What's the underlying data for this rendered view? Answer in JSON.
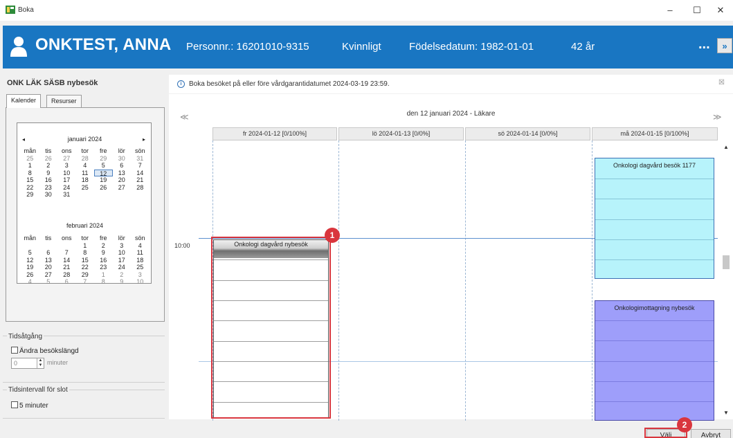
{
  "window": {
    "title": "Boka",
    "controls": [
      "–",
      "☐",
      "✕"
    ]
  },
  "patient": {
    "name": "ONKTEST, ANNA",
    "personnr": "Personnr.: 16201010-9315",
    "gender": "Kvinnligt",
    "birthdate": "Födelsedatum: 1982-01-01",
    "age": "42 år",
    "more_label": "...",
    "expand_label": "»"
  },
  "left": {
    "title": "ONK LÄK SÄSB nybesök",
    "tabs": [
      "Kalender",
      "Resurser"
    ],
    "calendar": {
      "prev": "◂",
      "next": "▸",
      "dow": [
        "mån",
        "tis",
        "ons",
        "tor",
        "fre",
        "lör",
        "sön"
      ],
      "january": {
        "title": "januari 2024",
        "days": [
          "25",
          "26",
          "27",
          "28",
          "29",
          "30",
          "31",
          "1",
          "2",
          "3",
          "4",
          "5",
          "6",
          "7",
          "8",
          "9",
          "10",
          "11",
          "12",
          "13",
          "14",
          "15",
          "16",
          "17",
          "18",
          "19",
          "20",
          "21",
          "22",
          "23",
          "24",
          "25",
          "26",
          "27",
          "28",
          "29",
          "30",
          "31"
        ]
      },
      "february": {
        "title": "februari 2024",
        "days": [
          "",
          "",
          "",
          "1",
          "2",
          "3",
          "4",
          "5",
          "6",
          "7",
          "8",
          "9",
          "10",
          "11",
          "12",
          "13",
          "14",
          "15",
          "16",
          "17",
          "18",
          "19",
          "20",
          "21",
          "22",
          "23",
          "24",
          "25",
          "26",
          "27",
          "28",
          "29",
          "1",
          "2",
          "3",
          "4",
          "5",
          "6",
          "7",
          "8",
          "9",
          "10"
        ]
      },
      "selected_day": "12"
    },
    "duration": {
      "label": "Tidsåtgång",
      "checkbox": "Ändra besökslängd",
      "value": "0",
      "unit": "minuter"
    },
    "interval": {
      "label": "Tidsintervall för slot",
      "checkbox": "5 minuter"
    }
  },
  "info": {
    "icon": "i",
    "text": "Boka besöket på eller före vårdgarantidatumet 2024-03-19 23:59.",
    "close": "☒"
  },
  "schedule": {
    "prev": "≪",
    "next": "≫",
    "title": "den 12 januari 2024 - Läkare",
    "columns": [
      "fr 2024-01-12  [0/100%]",
      "lö 2024-01-13  [0/0%]",
      "sö 2024-01-14  [0/0%]",
      "må 2024-01-15  [0/100%]"
    ],
    "time_label": "10:00",
    "blocks": {
      "grey": "Onkologi dagvård nybesök",
      "cyan": "Onkologi dagvård besök 1177",
      "violet": "Onkologimottagning nybesök"
    },
    "badges": [
      "1",
      "2"
    ]
  },
  "buttons": {
    "select": "Välj",
    "cancel": "Avbryt"
  },
  "colors": {
    "header_blue": "#1976c2",
    "highlight_red": "#d9363e",
    "cyan_block": "#b7f3fb",
    "violet_block": "#9e9efa"
  }
}
